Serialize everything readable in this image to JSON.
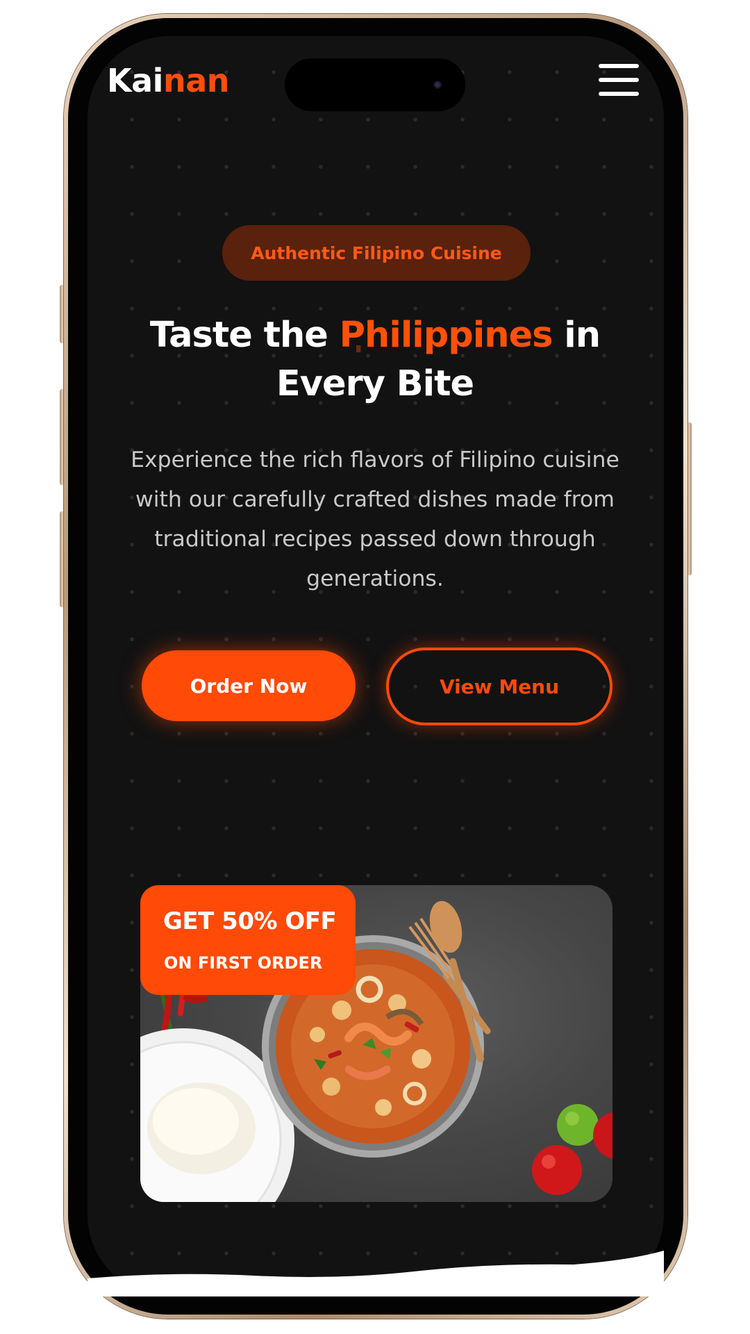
{
  "header": {
    "logo_part1": "Kai",
    "logo_part2": "nan",
    "menu_icon": "hamburger-menu-icon"
  },
  "hero": {
    "badge": "Authentic Filipino Cuisine",
    "headline_part1": "Taste the ",
    "headline_highlight": "Philippines",
    "headline_part2": " in Every Bite",
    "description": "Experience the rich flavors of Filipino cuisine with our carefully crafted dishes made from traditional recipes passed down through generations.",
    "primary_button": "Order Now",
    "secondary_button": "View Menu"
  },
  "promo": {
    "line1": "GET 50% OFF",
    "line2": "ON FIRST ORDER"
  },
  "colors": {
    "accent": "#ff4a08",
    "background": "#121212",
    "badge_bg": "#5a210d",
    "text_muted": "#c9c9c9"
  }
}
